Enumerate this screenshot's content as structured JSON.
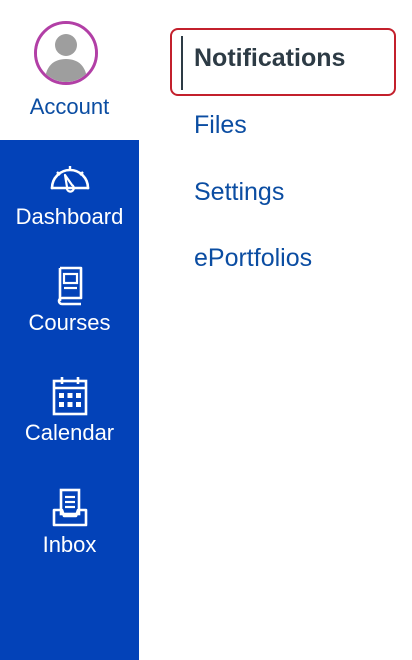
{
  "account": {
    "label": "Account",
    "avatar_border_color": "#b23fa6"
  },
  "global_nav": {
    "background_color": "#0342b8",
    "items": [
      {
        "label": "Dashboard",
        "icon": "dashboard-speedometer-icon"
      },
      {
        "label": "Courses",
        "icon": "courses-book-icon"
      },
      {
        "label": "Calendar",
        "icon": "calendar-icon"
      },
      {
        "label": "Inbox",
        "icon": "inbox-tray-icon"
      }
    ]
  },
  "account_menu": {
    "items": [
      {
        "label": "Notifications",
        "active": true
      },
      {
        "label": "Files",
        "active": false
      },
      {
        "label": "Settings",
        "active": false
      },
      {
        "label": "ePortfolios",
        "active": false
      }
    ],
    "highlight_color": "#c3202c"
  }
}
